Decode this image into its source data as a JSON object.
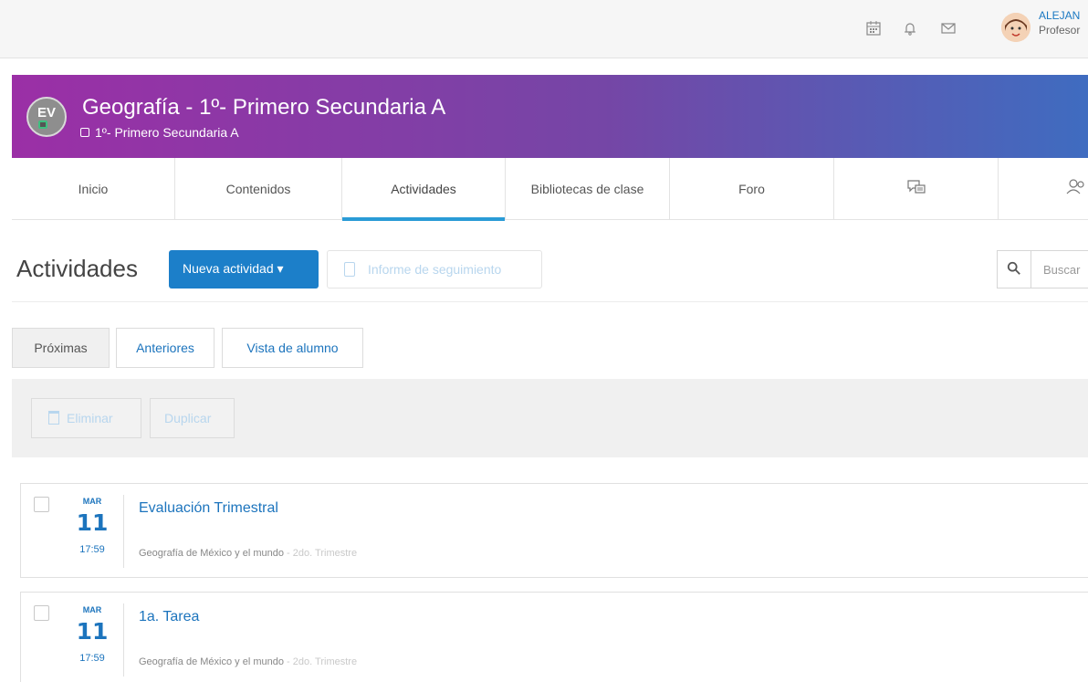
{
  "user": {
    "name": "ALEJAN",
    "role": "Profesor"
  },
  "course": {
    "badge": "EV",
    "title": "Geografía  - 1º- Primero Secundaria A",
    "subtitle": "1º- Primero Secundaria A"
  },
  "tabs": [
    {
      "label": "Inicio"
    },
    {
      "label": "Contenidos"
    },
    {
      "label": "Actividades"
    },
    {
      "label": "Bibliotecas de clase"
    },
    {
      "label": "Foro"
    }
  ],
  "toolbar": {
    "title": "Actividades",
    "new_label": "Nueva actividad ▾",
    "report_label": "Informe de seguimiento",
    "search_placeholder": "Buscar"
  },
  "filters": [
    {
      "label": "Próximas"
    },
    {
      "label": "Anteriores"
    },
    {
      "label": "Vista de alumno"
    }
  ],
  "actions": {
    "delete_label": "Eliminar",
    "duplicate_label": "Duplicar"
  },
  "activities": [
    {
      "month": "MAR",
      "day": "11",
      "time": "17:59",
      "title": "Evaluación Trimestral",
      "subject": "Geografía de México y el mundo",
      "term": " - 2do. Trimestre"
    },
    {
      "month": "MAR",
      "day": "11",
      "time": "17:59",
      "title": "1a. Tarea",
      "subject": "Geografía de México y el mundo",
      "term": " - 2do. Trimestre"
    }
  ],
  "colors": {
    "primary": "#1c7fc9",
    "banner_start": "#9b2fa6",
    "banner_end": "#3f6cc0",
    "tab_active": "#2a9bd6"
  },
  "icons": [
    "calendar-icon",
    "bell-icon",
    "mail-icon",
    "chat-screen-icon",
    "users-icon",
    "search-icon",
    "trash-icon",
    "document-icon"
  ]
}
